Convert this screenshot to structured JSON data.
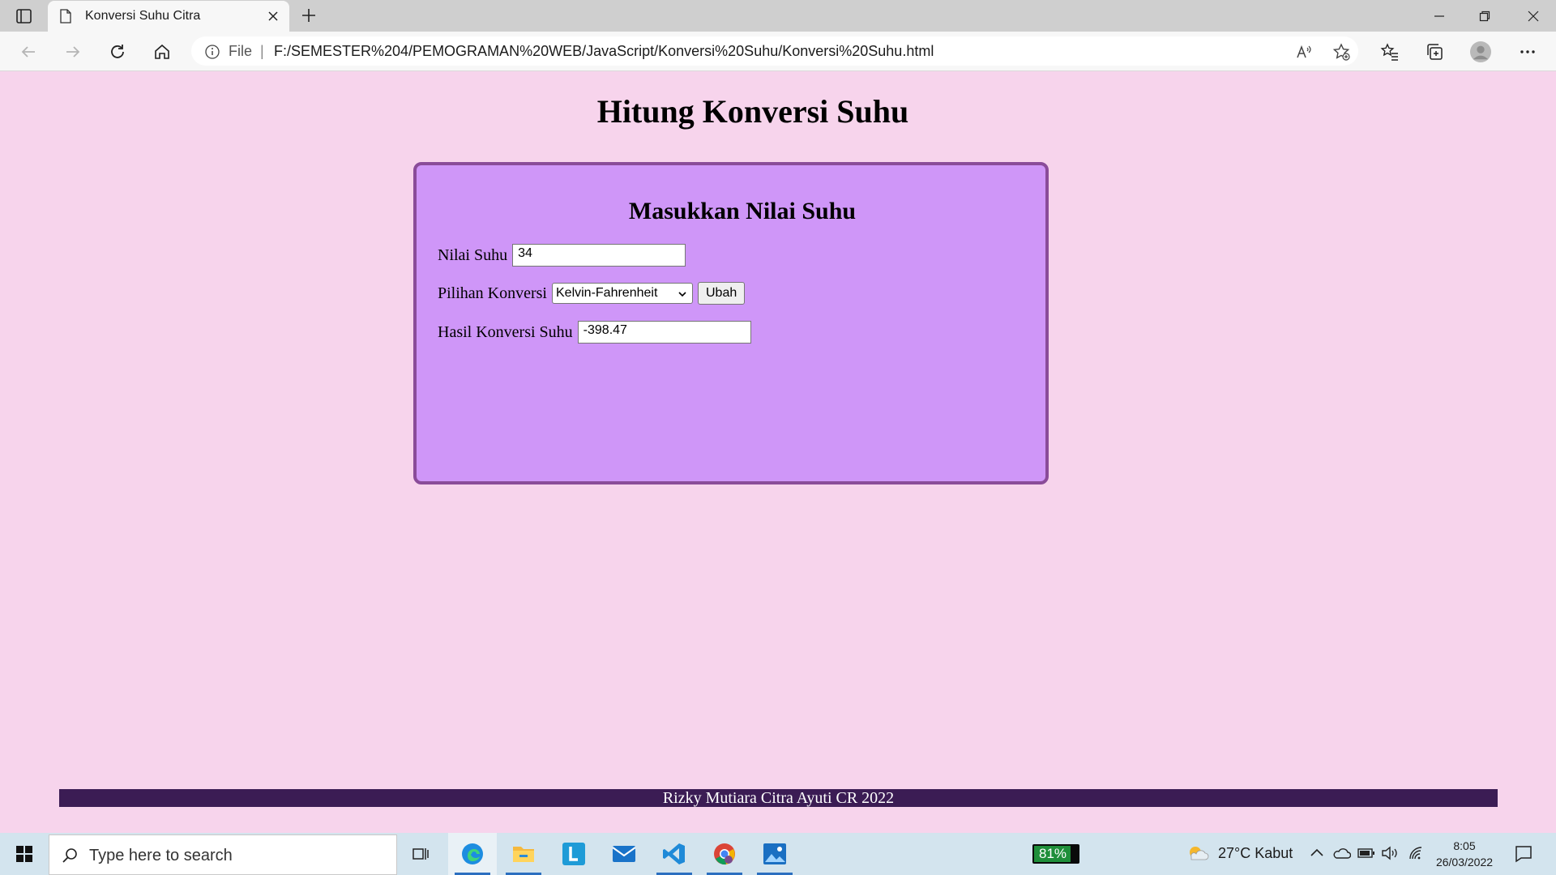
{
  "browser": {
    "tab_title": "Konversi Suhu Citra",
    "address_prefix": "File",
    "address_separator": "|",
    "url": "F:/SEMESTER%204/PEMOGRAMAN%20WEB/JavaScript/Konversi%20Suhu/Konversi%20Suhu.html"
  },
  "page": {
    "title": "Hitung Konversi Suhu",
    "card_title": "Masukkan Nilai Suhu",
    "nilai_label": "Nilai Suhu",
    "nilai_value": "34",
    "pilihan_label": "Pilihan Konversi",
    "pilihan_selected": "Kelvin-Fahrenheit",
    "button_label": "Ubah",
    "hasil_label": "Hasil Konversi Suhu",
    "hasil_value": "-398.47",
    "footer": "Rizky Mutiara Citra Ayuti CR 2022",
    "colors": {
      "background": "#f7d4ec",
      "card": "#cf96f8",
      "card_border": "#8a4c99",
      "footer": "#3b1c54"
    }
  },
  "taskbar": {
    "search_placeholder": "Type here to search",
    "battery": "81%",
    "weather": "27°C  Kabut",
    "time": "8:05",
    "date": "26/03/2022",
    "apps": [
      "task-view-icon",
      "edge-icon",
      "file-explorer-icon",
      "l-app-icon",
      "mail-icon",
      "vscode-icon",
      "chrome-icon",
      "photos-icon"
    ]
  }
}
